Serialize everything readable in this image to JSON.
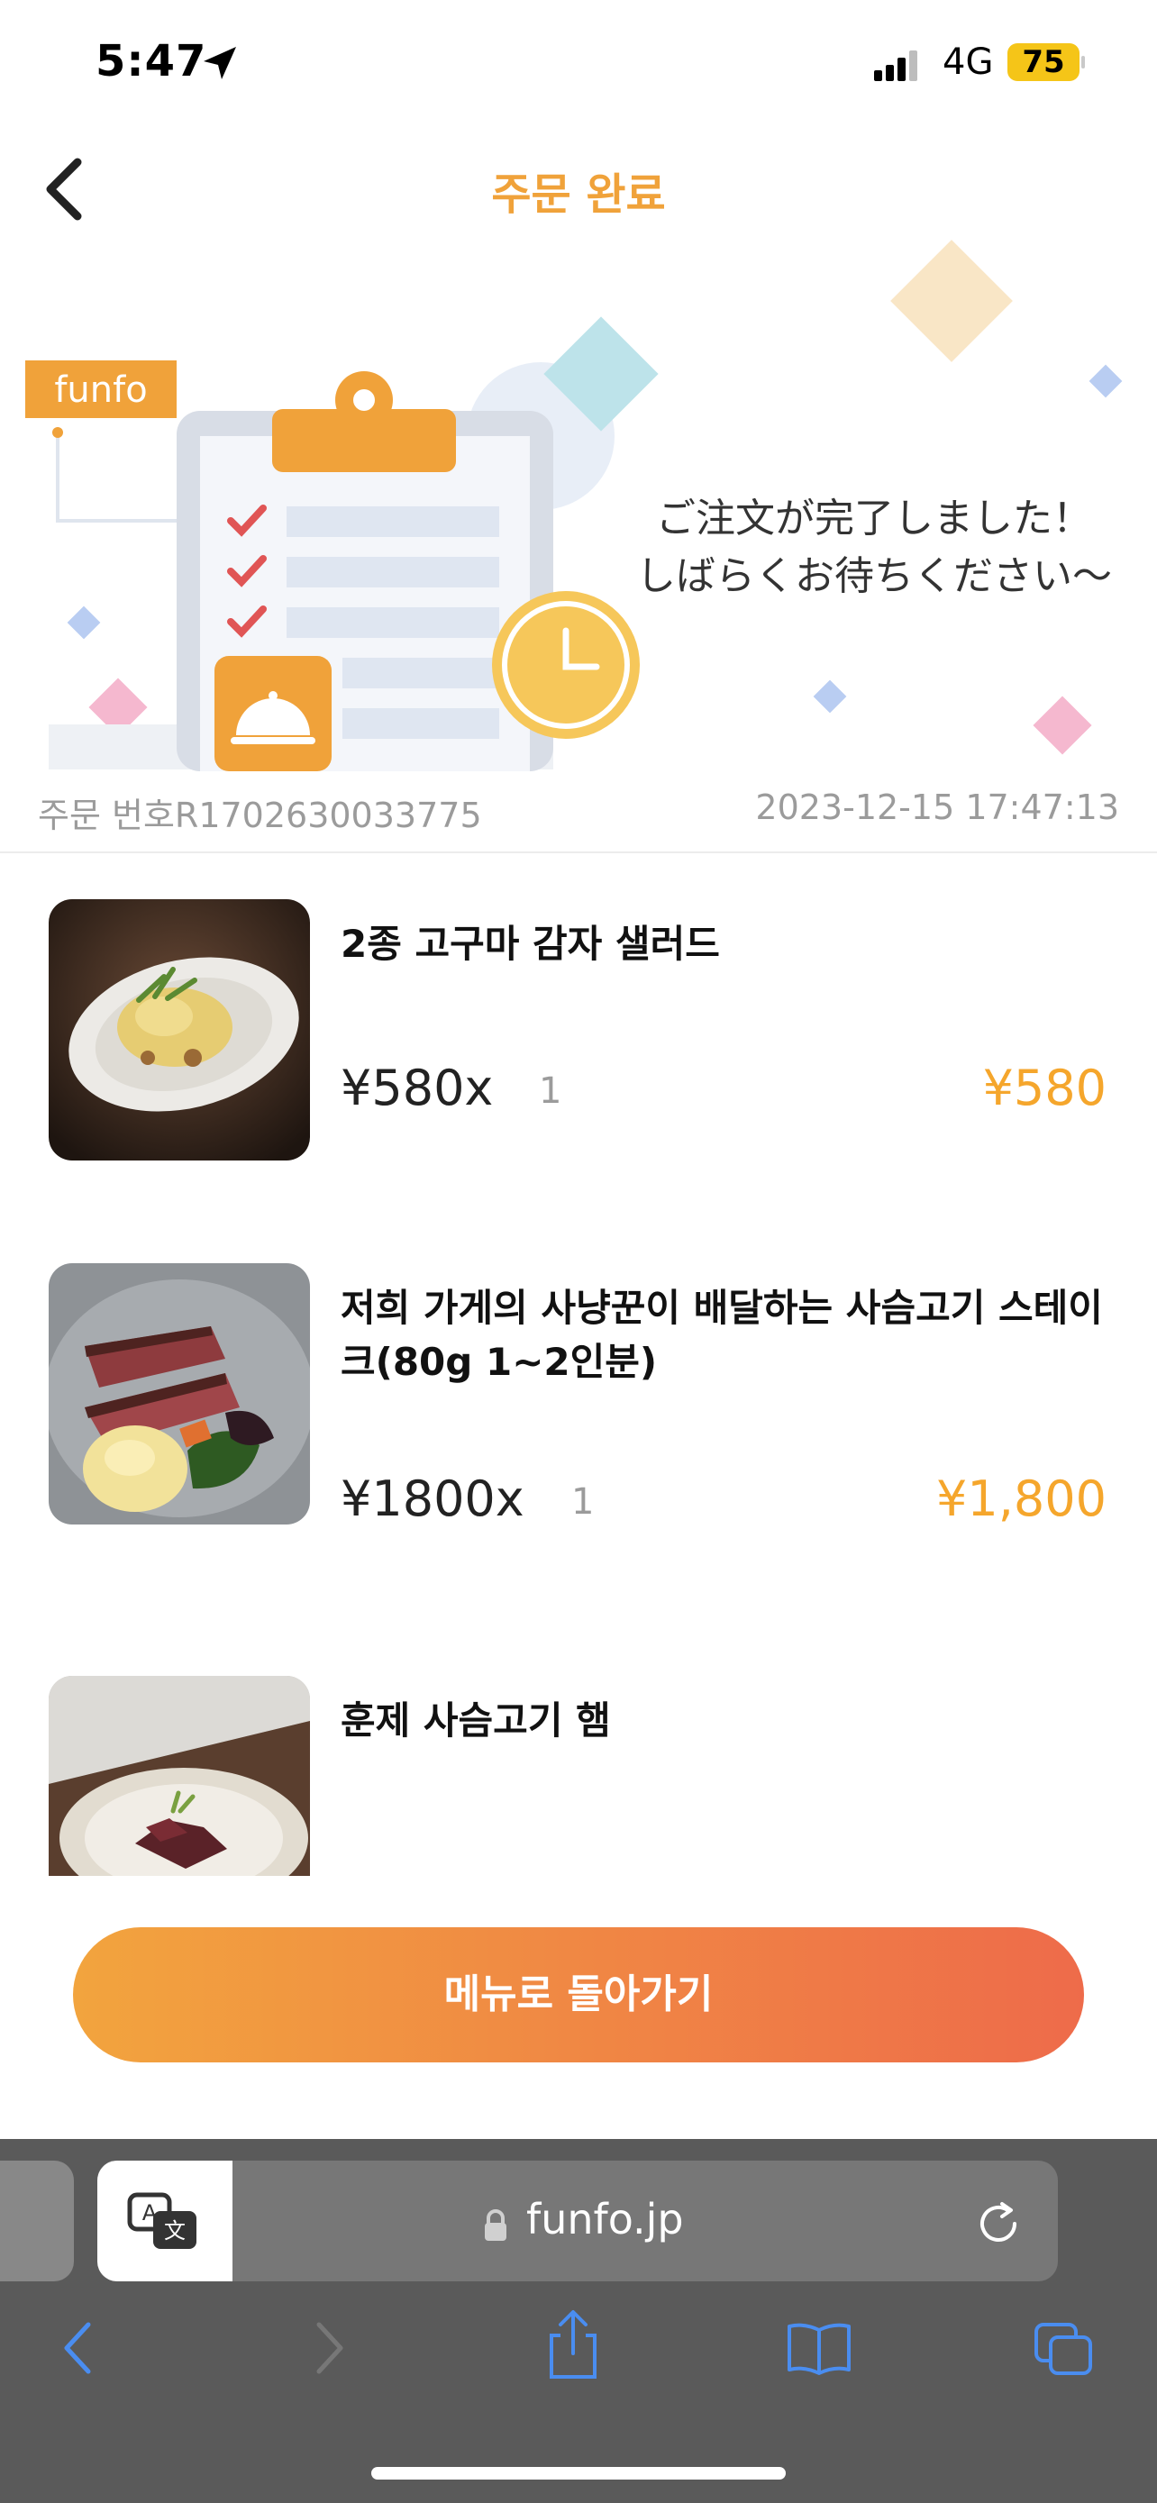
{
  "status_bar": {
    "time": "5:47",
    "network": "4G",
    "battery": "75"
  },
  "header": {
    "title": "주문 완료",
    "back_icon": "chevron-left-icon"
  },
  "banner": {
    "brand_tag": "funfo",
    "message_line1": "ご注文が完了しました！",
    "message_line2": "しばらくお待ちください〜",
    "order_number": "주문 번호R1702630033775",
    "order_datetime": "2023-12-15 17:47:13"
  },
  "items": [
    {
      "name": "2종 고구마 감자 샐러드",
      "unit_price": "¥580x",
      "qty": "1",
      "total": "¥580",
      "thumb_icon": "salad-dish-photo"
    },
    {
      "name": "저희 가게의 사냥꾼이 배달하는 사슴고기 스테이크(80g 1~2인분)",
      "unit_price": "¥1800x",
      "qty": "1",
      "total": "¥1,800",
      "thumb_icon": "venison-steak-photo"
    },
    {
      "name": "훈제 사슴고기 햄",
      "unit_price": "",
      "qty": "",
      "total": "",
      "thumb_icon": "smoked-venison-ham-photo"
    }
  ],
  "cta": {
    "label": "메뉴로 돌아가기"
  },
  "browser": {
    "url": "funfo.jp"
  },
  "colors": {
    "accent": "#f0a23a",
    "price": "#f5a62c",
    "cta_start": "#f2a43e",
    "cta_end": "#ee6b4a"
  }
}
